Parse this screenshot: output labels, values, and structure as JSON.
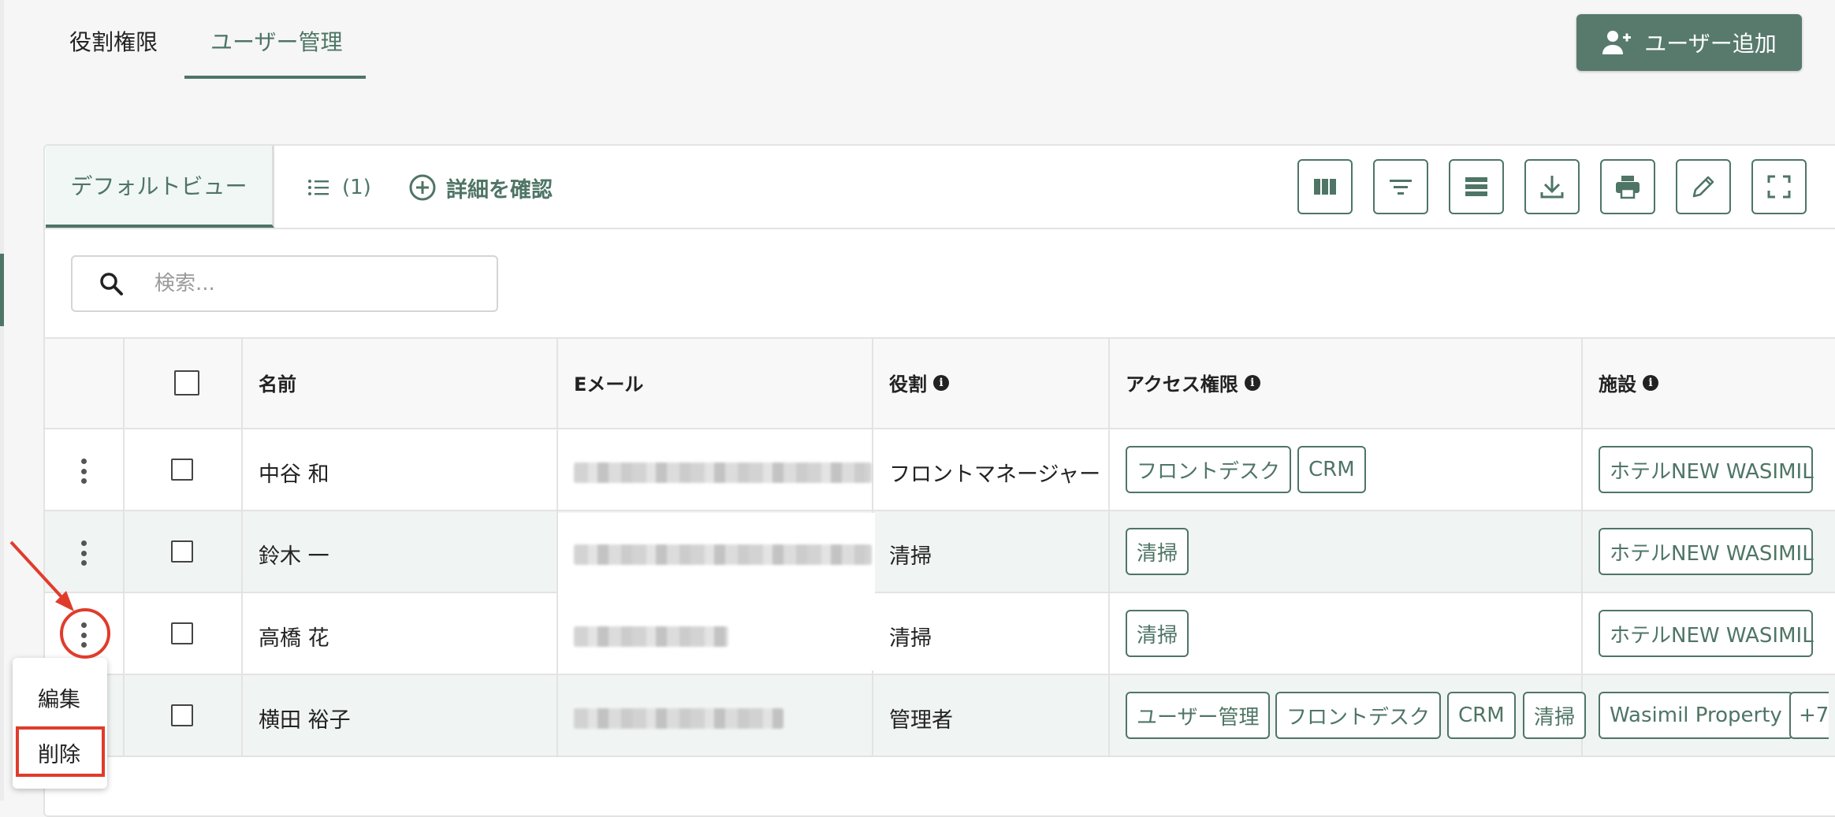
{
  "tabs": [
    {
      "label": "役割権限",
      "active": false
    },
    {
      "label": "ユーザー管理",
      "active": true
    }
  ],
  "add_user_button": {
    "label": "ユーザー追加",
    "icon": "user-plus-icon"
  },
  "toolbar": {
    "default_view": "デフォルトビュー",
    "list_count": "(1)",
    "details": "詳細を確認",
    "tools": [
      "columns-icon",
      "filter-icon",
      "density-icon",
      "download-icon",
      "print-icon",
      "edit-icon",
      "fullscreen-icon"
    ]
  },
  "search": {
    "placeholder": "検索..."
  },
  "table": {
    "headers": {
      "name": "名前",
      "email": "Eメール",
      "role": "役割",
      "access": "アクセス権限",
      "facility": "施設"
    },
    "rows": [
      {
        "name": "中谷 和",
        "role": "フロントマネージャー",
        "access": [
          "フロントデスク",
          "CRM"
        ],
        "facility": [
          "ホテルNEW WASIMIL"
        ]
      },
      {
        "name": "鈴木 一",
        "role": "清掃",
        "access": [
          "清掃"
        ],
        "facility": [
          "ホテルNEW WASIMIL"
        ]
      },
      {
        "name": "高橋 花",
        "role": "清掃",
        "access": [
          "清掃"
        ],
        "facility": [
          "ホテルNEW WASIMIL"
        ]
      },
      {
        "name": "横田 裕子",
        "role": "管理者",
        "access": [
          "ユーザー管理",
          "フロントデスク",
          "CRM",
          "清掃"
        ],
        "facility": [
          "Wasimil Property",
          "+7"
        ]
      }
    ]
  },
  "row_menu": {
    "items": [
      "編集",
      "削除"
    ],
    "highlighted": "削除"
  },
  "colors": {
    "accent": "#4e7566",
    "button_bg": "#577a6d",
    "highlight": "#e03c2c"
  }
}
